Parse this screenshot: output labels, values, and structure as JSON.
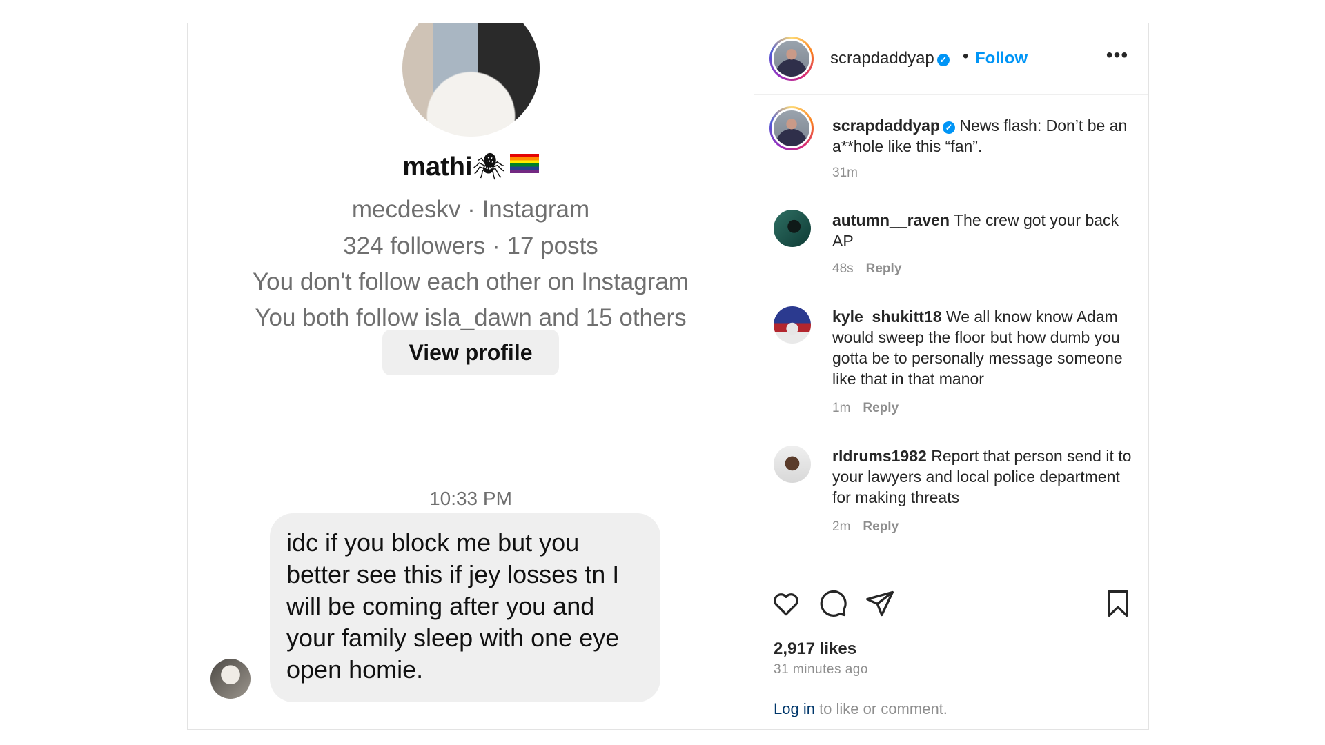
{
  "dm": {
    "display_name": "mathi",
    "name_glyph": "🕷",
    "handle_line": "mecdeskv · Instagram",
    "stats_line": "324 followers · 17 posts",
    "follow_status": "You don't follow each other on Instagram",
    "mutuals": "You both follow isla_dawn and 15 others",
    "view_profile_label": "View profile",
    "timestamp": "10:33 PM",
    "message": "idc if you block me but you better see this if jey losses tn I will be coming after you and your family sleep with one eye open homie."
  },
  "post": {
    "author": "scrapdaddyap",
    "verified_mark": "✓",
    "separator": "•",
    "follow_label": "Follow",
    "more_label": "•••",
    "caption": {
      "author": "scrapdaddyap",
      "text": "News flash: Don’t be an a**hole like this “fan”.",
      "time": "31m"
    },
    "comments": [
      {
        "user": "autumn__raven",
        "text": "The crew got your back AP",
        "time": "48s",
        "reply_label": "Reply"
      },
      {
        "user": "kyle_shukitt18",
        "text": "We all know know Adam would sweep the floor but how dumb you gotta be to personally message someone like that in that manor",
        "time": "1m",
        "reply_label": "Reply"
      },
      {
        "user": "rldrums1982",
        "text": "Report that person send it to your lawyers and local police department for making threats",
        "time": "2m",
        "reply_label": "Reply"
      }
    ],
    "likes": "2,917 likes",
    "posted_ago": "31 minutes ago",
    "login_link": "Log in",
    "login_suffix": " to like or comment."
  },
  "colors": {
    "accent": "#0095f6",
    "muted": "#8e8e8e",
    "bubble": "#efefef"
  },
  "icons": [
    "heart-icon",
    "comment-icon",
    "share-icon",
    "bookmark-icon",
    "verified-icon",
    "more-icon"
  ]
}
